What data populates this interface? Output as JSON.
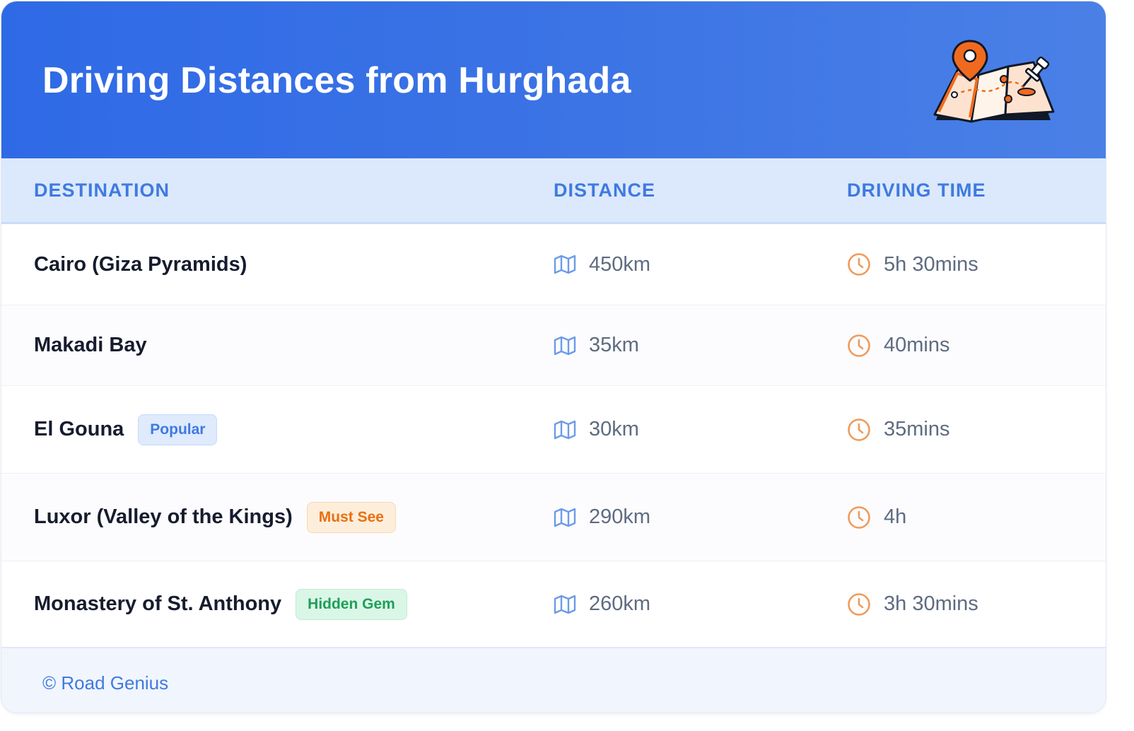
{
  "header": {
    "title": "Driving Distances from Hurghada",
    "illustration": "map-with-pins-icon"
  },
  "columns": {
    "destination": "DESTINATION",
    "distance": "DISTANCE",
    "driving_time": "DRIVING TIME"
  },
  "icons": {
    "distance": "map-icon",
    "time": "clock-icon"
  },
  "colors": {
    "header_start": "#2f6ae6",
    "header_end": "#4a80e6",
    "accent_blue": "#3f7ae0",
    "accent_orange": "#ea6f10",
    "accent_green": "#1f9e5a"
  },
  "rows": [
    {
      "destination": "Cairo (Giza Pyramids)",
      "badge": "",
      "distance": "450km",
      "time": "5h 30mins"
    },
    {
      "destination": "Makadi Bay",
      "badge": "",
      "distance": "35km",
      "time": "40mins"
    },
    {
      "destination": "El Gouna",
      "badge": "Popular",
      "distance": "30km",
      "time": "35mins"
    },
    {
      "destination": "Luxor (Valley of the Kings)",
      "badge": "Must See",
      "distance": "290km",
      "time": "4h"
    },
    {
      "destination": "Monastery of St. Anthony",
      "badge": "Hidden Gem",
      "distance": "260km",
      "time": "3h 30mins"
    }
  ],
  "footer": {
    "text": "© Road Genius"
  }
}
